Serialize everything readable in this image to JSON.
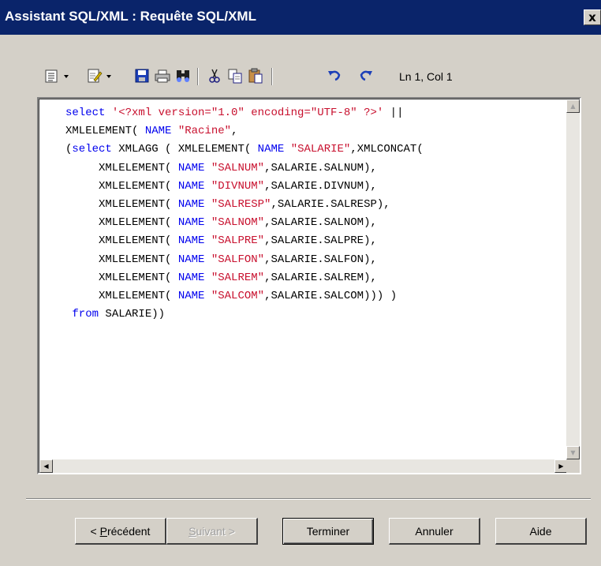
{
  "window": {
    "title": "Assistant SQL/XML : Requête SQL/XML",
    "close_label": "x"
  },
  "toolbar": {
    "icons": [
      "properties-menu-icon",
      "edit-menu-icon",
      "save-icon",
      "print-icon",
      "find-icon",
      "cut-icon",
      "copy-icon",
      "paste-icon",
      "undo-icon",
      "redo-icon"
    ],
    "cursor_position": "Ln 1, Col 1"
  },
  "editor": {
    "lines": [
      [
        {
          "t": "select ",
          "c": "kw"
        },
        {
          "t": "'<?xml version=\"1.0\" encoding=\"UTF-8\" ?>'",
          "c": "str"
        },
        {
          "t": " ||",
          "c": ""
        }
      ],
      [
        {
          "t": "XMLELEMENT( ",
          "c": ""
        },
        {
          "t": "NAME",
          "c": "kw"
        },
        {
          "t": " ",
          "c": ""
        },
        {
          "t": "\"Racine\"",
          "c": "str"
        },
        {
          "t": ",",
          "c": ""
        }
      ],
      [
        {
          "t": "(",
          "c": ""
        },
        {
          "t": "select",
          "c": "kw"
        },
        {
          "t": " XMLAGG ( XMLELEMENT( ",
          "c": ""
        },
        {
          "t": "NAME",
          "c": "kw"
        },
        {
          "t": " ",
          "c": ""
        },
        {
          "t": "\"SALARIE\"",
          "c": "str"
        },
        {
          "t": ",XMLCONCAT(",
          "c": ""
        }
      ],
      [
        {
          "t": "     XMLELEMENT( ",
          "c": ""
        },
        {
          "t": "NAME",
          "c": "kw"
        },
        {
          "t": " ",
          "c": ""
        },
        {
          "t": "\"SALNUM\"",
          "c": "str"
        },
        {
          "t": ",SALARIE.SALNUM),",
          "c": ""
        }
      ],
      [
        {
          "t": "     XMLELEMENT( ",
          "c": ""
        },
        {
          "t": "NAME",
          "c": "kw"
        },
        {
          "t": " ",
          "c": ""
        },
        {
          "t": "\"DIVNUM\"",
          "c": "str"
        },
        {
          "t": ",SALARIE.DIVNUM),",
          "c": ""
        }
      ],
      [
        {
          "t": "     XMLELEMENT( ",
          "c": ""
        },
        {
          "t": "NAME",
          "c": "kw"
        },
        {
          "t": " ",
          "c": ""
        },
        {
          "t": "\"SALRESP\"",
          "c": "str"
        },
        {
          "t": ",SALARIE.SALRESP),",
          "c": ""
        }
      ],
      [
        {
          "t": "     XMLELEMENT( ",
          "c": ""
        },
        {
          "t": "NAME",
          "c": "kw"
        },
        {
          "t": " ",
          "c": ""
        },
        {
          "t": "\"SALNOM\"",
          "c": "str"
        },
        {
          "t": ",SALARIE.SALNOM),",
          "c": ""
        }
      ],
      [
        {
          "t": "     XMLELEMENT( ",
          "c": ""
        },
        {
          "t": "NAME",
          "c": "kw"
        },
        {
          "t": " ",
          "c": ""
        },
        {
          "t": "\"SALPRE\"",
          "c": "str"
        },
        {
          "t": ",SALARIE.SALPRE),",
          "c": ""
        }
      ],
      [
        {
          "t": "     XMLELEMENT( ",
          "c": ""
        },
        {
          "t": "NAME",
          "c": "kw"
        },
        {
          "t": " ",
          "c": ""
        },
        {
          "t": "\"SALFON\"",
          "c": "str"
        },
        {
          "t": ",SALARIE.SALFON),",
          "c": ""
        }
      ],
      [
        {
          "t": "     XMLELEMENT( ",
          "c": ""
        },
        {
          "t": "NAME",
          "c": "kw"
        },
        {
          "t": " ",
          "c": ""
        },
        {
          "t": "\"SALREM\"",
          "c": "str"
        },
        {
          "t": ",SALARIE.SALREM),",
          "c": ""
        }
      ],
      [
        {
          "t": "     XMLELEMENT( ",
          "c": ""
        },
        {
          "t": "NAME",
          "c": "kw"
        },
        {
          "t": " ",
          "c": ""
        },
        {
          "t": "\"SALCOM\"",
          "c": "str"
        },
        {
          "t": ",SALARIE.SALCOM))) )",
          "c": ""
        }
      ],
      [
        {
          "t": " ",
          "c": ""
        },
        {
          "t": "from",
          "c": "kw"
        },
        {
          "t": " SALARIE))",
          "c": ""
        }
      ]
    ]
  },
  "buttons": {
    "previous_prefix": "< ",
    "previous_mnemonic": "P",
    "previous_rest": "récédent",
    "next_mnemonic": "S",
    "next_rest": "uivant >",
    "finish": "Terminer",
    "cancel": "Annuler",
    "help": "Aide"
  },
  "colors": {
    "titlebar": "#0a246a",
    "keyword": "#0000ee",
    "string": "#c8102e",
    "dialog_bg": "#d4d0c8"
  }
}
